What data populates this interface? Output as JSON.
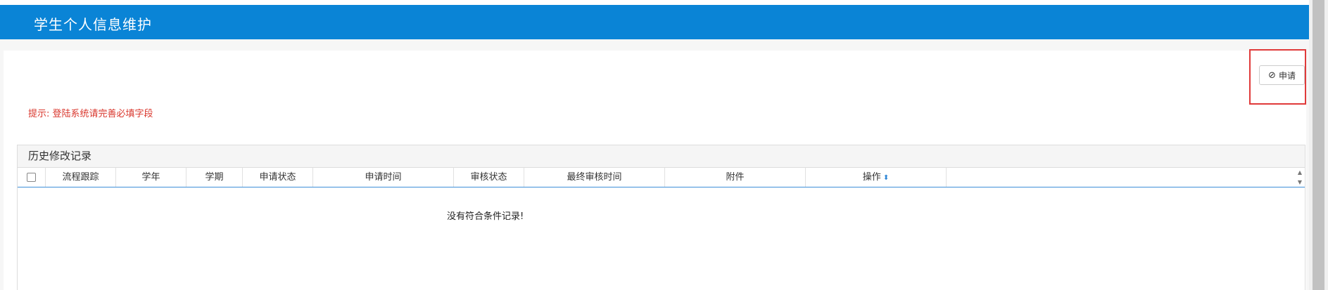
{
  "header": {
    "title": "学生个人信息维护"
  },
  "toolbar": {
    "apply_label": "申请",
    "apply_icon": "ban-icon"
  },
  "hint": {
    "text": "提示: 登陆系统请完善必填字段"
  },
  "panel": {
    "title": "历史修改记录"
  },
  "table": {
    "columns": [
      "流程跟踪",
      "学年",
      "学期",
      "申请状态",
      "申请时间",
      "审核状态",
      "最终审核时间",
      "附件",
      "操作"
    ],
    "empty_text": "没有符合条件记录!"
  },
  "colors": {
    "header_bg": "#0a84d6",
    "hint": "#d9372d",
    "highlight": "#e03a3a"
  }
}
